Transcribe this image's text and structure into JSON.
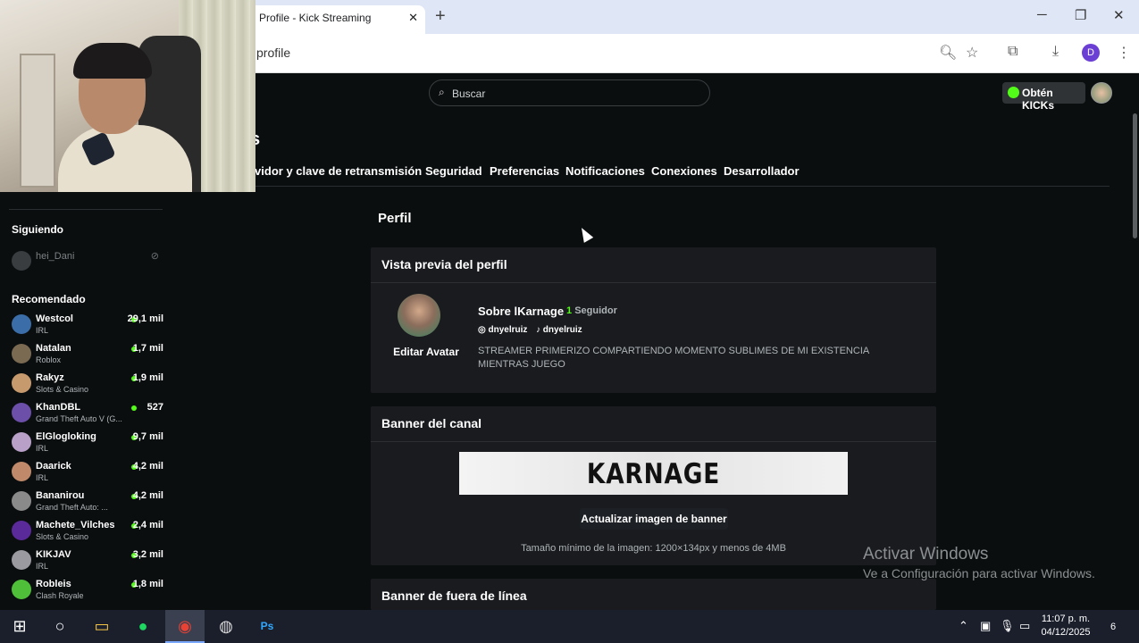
{
  "browser": {
    "tab_title": "Profile - Kick Streaming",
    "close_tab": "✕",
    "new_tab": "+",
    "url": "profile",
    "window_min": "─",
    "window_max": "❐",
    "window_close": "✕",
    "profile_letter": "D"
  },
  "topbar": {
    "search_placeholder": "Buscar",
    "kicks_label": "Obtén KICKs"
  },
  "settings": {
    "title": "s",
    "tabs": [
      "rvidor y clave de retransmisión",
      "Seguridad",
      "Preferencias",
      "Notificaciones",
      "Conexiones",
      "Desarrollador"
    ]
  },
  "sidebar": {
    "following_heading": "Siguiendo",
    "following": [
      {
        "name": "hei_Dani"
      }
    ],
    "recommended_heading": "Recomendado",
    "recommended": [
      {
        "name": "Westcol",
        "category": "IRL",
        "viewers": "29,1 mil",
        "color": "#3b6ea8"
      },
      {
        "name": "Natalan",
        "category": "Roblox",
        "viewers": "1,7 mil",
        "color": "#7a6a52"
      },
      {
        "name": "Rakyz",
        "category": "Slots & Casino",
        "viewers": "1,9 mil",
        "color": "#c79a6d"
      },
      {
        "name": "KhanDBL",
        "category": "Grand Theft Auto V (G...",
        "viewers": "527",
        "color": "#6b4fa8"
      },
      {
        "name": "ElGlogloking",
        "category": "IRL",
        "viewers": "9,7 mil",
        "color": "#b8a0c8"
      },
      {
        "name": "Daarick",
        "category": "IRL",
        "viewers": "4,2 mil",
        "color": "#c08a6a"
      },
      {
        "name": "Bananirou",
        "category": "Grand Theft Auto: ...",
        "viewers": "4,2 mil",
        "color": "#8a8a8a"
      },
      {
        "name": "Machete_Vilches",
        "category": "Slots & Casino",
        "viewers": "2,4 mil",
        "color": "#5a2a9a"
      },
      {
        "name": "KIKJAV",
        "category": "IRL",
        "viewers": "3,2 mil",
        "color": "#9a9aa0"
      },
      {
        "name": "Robleis",
        "category": "Clash Royale",
        "viewers": "1,8 mil",
        "color": "#4fbf3a"
      }
    ]
  },
  "page": {
    "heading": "Perfil",
    "preview": {
      "title": "Vista previa del perfil",
      "edit_avatar": "Editar Avatar",
      "about": "Sobre lKarnage",
      "followers_count": "1",
      "followers_label": "Seguidor",
      "instagram": "dnyelruiz",
      "tiktok": "dnyelruiz",
      "bio": "STREAMER PRIMERIZO COMPARTIENDO MOMENTO SUBLIMES DE MI EXISTENCIA MIENTRAS JUEGO"
    },
    "banner": {
      "title": "Banner del canal",
      "image_text": "KARNAGE",
      "update_button": "Actualizar imagen de banner",
      "hint": "Tamaño mínimo de la imagen: 1200×134px y menos de 4MB"
    },
    "offline_banner": {
      "title": "Banner de fuera de línea"
    }
  },
  "watermark": {
    "line1": "Activar Windows",
    "line2": "Ve a Configuración para activar Windows."
  },
  "taskbar": {
    "time": "11:07 p. m.",
    "date": "04/12/2025",
    "notifications": "6"
  },
  "colors": {
    "accent_green": "#53fc18",
    "background": "#0b0e0f",
    "card": "#191b1f"
  }
}
